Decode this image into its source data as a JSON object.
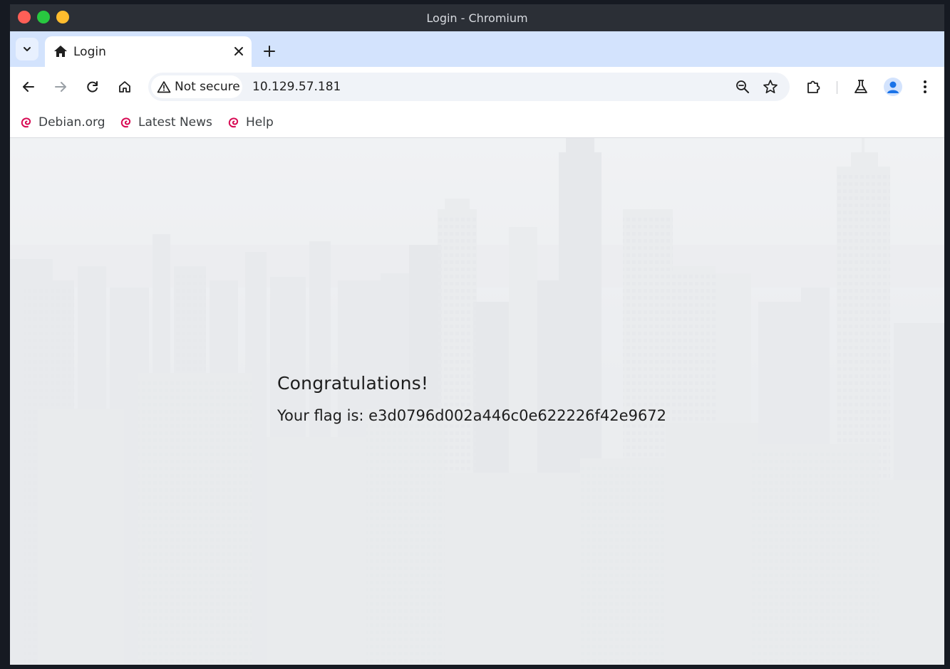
{
  "window": {
    "title": "Login - Chromium"
  },
  "tabs": [
    {
      "label": "Login",
      "icon": "home-icon",
      "active": true
    }
  ],
  "toolbar": {
    "security_label": "Not secure",
    "url": "10.129.57.181"
  },
  "bookmarks": [
    {
      "label": "Debian.org",
      "icon": "debian-swirl-icon"
    },
    {
      "label": "Latest News",
      "icon": "debian-swirl-icon"
    },
    {
      "label": "Help",
      "icon": "debian-swirl-icon"
    }
  ],
  "page": {
    "heading": "Congratulations!",
    "flag_text": "Your flag is: e3d0796d002a446c0e622226f42e9672"
  },
  "colors": {
    "titlebar": "#2b2f36",
    "tabstrip": "#d3e3fd",
    "accent": "#1a73e8",
    "debian_red": "#d70a53"
  }
}
